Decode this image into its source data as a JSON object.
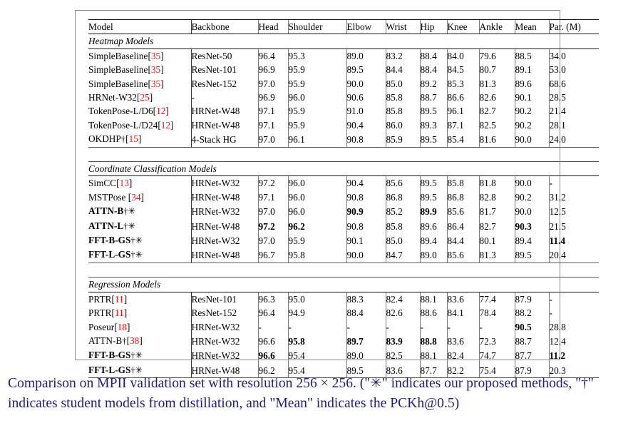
{
  "table": {
    "columns": [
      "Model",
      "Backbone",
      "Head",
      "Shoulder",
      "Elbow",
      "Wrist",
      "Hip",
      "Knee",
      "Ankle",
      "Mean",
      "Par. (M)"
    ],
    "sections": [
      {
        "title": "Heatmap Models",
        "rows": [
          {
            "model": "SimpleBaseline",
            "cite": "35",
            "bold_name": false,
            "dagger": false,
            "star": false,
            "backbone": "ResNet-50",
            "values": [
              "96.4",
              "95.3",
              "89.0",
              "83.2",
              "88.4",
              "84.0",
              "79.6",
              "88.5",
              "34.0"
            ],
            "bold": [
              false,
              false,
              false,
              false,
              false,
              false,
              false,
              false,
              false
            ]
          },
          {
            "model": "SimpleBaseline",
            "cite": "35",
            "bold_name": false,
            "dagger": false,
            "star": false,
            "backbone": "ResNet-101",
            "values": [
              "96.9",
              "95.9",
              "89.5",
              "84.4",
              "88.4",
              "84.5",
              "80.7",
              "89.1",
              "53.0"
            ],
            "bold": [
              false,
              false,
              false,
              false,
              false,
              false,
              false,
              false,
              false
            ]
          },
          {
            "model": "SimpleBaseline",
            "cite": "35",
            "bold_name": false,
            "dagger": false,
            "star": false,
            "backbone": "ResNet-152",
            "values": [
              "97.0",
              "95.9",
              "90.0",
              "85.0",
              "89.2",
              "85.3",
              "81.3",
              "89.6",
              "68.6"
            ],
            "bold": [
              false,
              false,
              false,
              false,
              false,
              false,
              false,
              false,
              false
            ]
          },
          {
            "model": "HRNet-W32",
            "cite": "25",
            "bold_name": false,
            "dagger": false,
            "star": false,
            "backbone": "-",
            "values": [
              "96.9",
              "96.0",
              "90.6",
              "85.8",
              "88.7",
              "86.6",
              "82.6",
              "90.1",
              "28.5"
            ],
            "bold": [
              false,
              false,
              false,
              false,
              false,
              false,
              false,
              false,
              false
            ]
          },
          {
            "model": "TokenPose-L/D6",
            "cite": "12",
            "bold_name": false,
            "dagger": false,
            "star": false,
            "backbone": "HRNet-W48",
            "values": [
              "97.1",
              "95.9",
              "91.0",
              "85.8",
              "89.5",
              "96.1",
              "82.7",
              "90.2",
              "21.4"
            ],
            "bold": [
              false,
              false,
              false,
              false,
              false,
              false,
              false,
              false,
              false
            ]
          },
          {
            "model": "TokenPose-L/D24",
            "cite": "12",
            "bold_name": false,
            "dagger": false,
            "star": false,
            "backbone": "HRNet-W48",
            "values": [
              "97.1",
              "95.9",
              "90.4",
              "86.0",
              "89.3",
              "87.1",
              "82.5",
              "90.2",
              "28.1"
            ],
            "bold": [
              false,
              false,
              false,
              false,
              false,
              false,
              false,
              false,
              false
            ]
          },
          {
            "model": "OKDHP",
            "cite": "15",
            "bold_name": false,
            "dagger": true,
            "star": false,
            "backbone": "4-Stack HG",
            "values": [
              "97.0",
              "96.1",
              "90.8",
              "85.9",
              "89.5",
              "85.4",
              "81.6",
              "90.0",
              "24.0"
            ],
            "bold": [
              false,
              false,
              false,
              false,
              false,
              false,
              false,
              false,
              false
            ]
          }
        ]
      },
      {
        "title": "Coordinate Classification Models",
        "rows": [
          {
            "model": "SimCC",
            "cite": "13",
            "bold_name": false,
            "dagger": false,
            "star": false,
            "backbone": "HRNet-W32",
            "values": [
              "97.2",
              "96.0",
              "90.4",
              "85.6",
              "89.5",
              "85.8",
              "81.8",
              "90.0",
              "-"
            ],
            "bold": [
              false,
              false,
              false,
              false,
              false,
              false,
              false,
              false,
              false
            ]
          },
          {
            "model": "MSTPose ",
            "cite": "34",
            "bold_name": false,
            "dagger": false,
            "star": false,
            "backbone": "HRNet-W48",
            "values": [
              "97.1",
              "96.0",
              "90.8",
              "86.8",
              "89.5",
              "86.8",
              "82.8",
              "90.2",
              "31.2"
            ],
            "bold": [
              false,
              false,
              false,
              false,
              false,
              false,
              false,
              false,
              false
            ]
          },
          {
            "model": "ATTN-B",
            "cite": "",
            "bold_name": true,
            "dagger": true,
            "star": true,
            "backbone": "HRNet-W32",
            "values": [
              "97.0",
              "96.0",
              "90.9",
              "85.2",
              "89.9",
              "85.6",
              "81.7",
              "90.0",
              "12.5"
            ],
            "bold": [
              false,
              false,
              true,
              false,
              true,
              false,
              false,
              false,
              false
            ]
          },
          {
            "model": "ATTN-L",
            "cite": "",
            "bold_name": true,
            "dagger": true,
            "star": true,
            "backbone": "HRNet-W48",
            "values": [
              "97.2",
              "96.2",
              "90.8",
              "85.8",
              "89.6",
              "86.4",
              "82.7",
              "90.3",
              "21.5"
            ],
            "bold": [
              true,
              true,
              false,
              false,
              false,
              false,
              false,
              true,
              false
            ]
          },
          {
            "model": "FFT-B-GS",
            "cite": "",
            "bold_name": true,
            "dagger": true,
            "star": true,
            "backbone": "HRNet-W32",
            "values": [
              "97.0",
              "95.9",
              "90.1",
              "85.0",
              "89.4",
              "84.4",
              "80.1",
              "89.4",
              "11.4"
            ],
            "bold": [
              false,
              false,
              false,
              false,
              false,
              false,
              false,
              false,
              true
            ]
          },
          {
            "model": "FFT-L-GS",
            "cite": "",
            "bold_name": true,
            "dagger": true,
            "star": true,
            "backbone": "HRNet-W48",
            "values": [
              "96.7",
              "95.8",
              "90.0",
              "84.7",
              "89.0",
              "85.6",
              "81.3",
              "89.5",
              "20.4"
            ],
            "bold": [
              false,
              false,
              false,
              false,
              false,
              false,
              false,
              false,
              false
            ]
          }
        ]
      },
      {
        "title": "Regression Models",
        "rows": [
          {
            "model": "PRTR",
            "cite": "11",
            "bold_name": false,
            "dagger": false,
            "star": false,
            "backbone": "ResNet-101",
            "values": [
              "96.3",
              "95.0",
              "88.3",
              "82.4",
              "88.1",
              "83.6",
              "77.4",
              "87.9",
              "-"
            ],
            "bold": [
              false,
              false,
              false,
              false,
              false,
              false,
              false,
              false,
              false
            ]
          },
          {
            "model": "PRTR",
            "cite": "11",
            "bold_name": false,
            "dagger": false,
            "star": false,
            "backbone": "ResNet-152",
            "values": [
              "96.4",
              "94.9",
              "88.4",
              "82.6",
              "88.6",
              "84.1",
              "78.4",
              "88.2",
              "-"
            ],
            "bold": [
              false,
              false,
              false,
              false,
              false,
              false,
              false,
              false,
              false
            ]
          },
          {
            "model": "Poseur",
            "cite": "18",
            "bold_name": false,
            "dagger": false,
            "star": false,
            "backbone": "HRNet-W32",
            "values": [
              "-",
              "-",
              "-",
              "-",
              "-",
              "-",
              "-",
              "90.5",
              "28.8"
            ],
            "bold": [
              false,
              false,
              false,
              false,
              false,
              false,
              false,
              true,
              false
            ]
          },
          {
            "model": "ATTN-B",
            "cite": "38",
            "bold_name": false,
            "dagger": true,
            "star": false,
            "backbone": "HRNet-W32",
            "values": [
              "96.6",
              "95.8",
              "89.7",
              "83.9",
              "88.8",
              "83.6",
              "72.3",
              "88.7",
              "12.4"
            ],
            "bold": [
              false,
              true,
              true,
              true,
              true,
              false,
              false,
              false,
              false
            ]
          },
          {
            "model": "FFT-B-GS",
            "cite": "",
            "bold_name": true,
            "dagger": true,
            "star": true,
            "backbone": "HRNet-W32",
            "values": [
              "96.6",
              "95.4",
              "89.0",
              "82.5",
              "88.1",
              "82.4",
              "74.7",
              "87.7",
              "11.2"
            ],
            "bold": [
              true,
              false,
              false,
              false,
              false,
              false,
              false,
              false,
              true
            ]
          },
          {
            "model": "FFT-L-GS",
            "cite": "",
            "bold_name": true,
            "dagger": true,
            "star": true,
            "backbone": "HRNet-W48",
            "values": [
              "96.2",
              "95.4",
              "89.5",
              "83.6",
              "87.7",
              "82.2",
              "75.4",
              "87.9",
              "20.3"
            ],
            "bold": [
              false,
              false,
              false,
              false,
              false,
              false,
              false,
              false,
              false
            ]
          }
        ]
      }
    ]
  },
  "caption": {
    "text": "Comparison on MPII validation set with resolution 256 × 256. (\"✳\" indicates our proposed methods, \"†\" indicates student models from distillation, and \"Mean\" indicates the PCKh@0.5)",
    "color": "#1f1f7a"
  },
  "symbols": {
    "dagger": "†",
    "star": "✳",
    "dash": "-"
  },
  "colors": {
    "citation": "#ee1111",
    "caption": "#1f1f7a",
    "rule": "#111111",
    "frame": "#8a8a8a"
  }
}
